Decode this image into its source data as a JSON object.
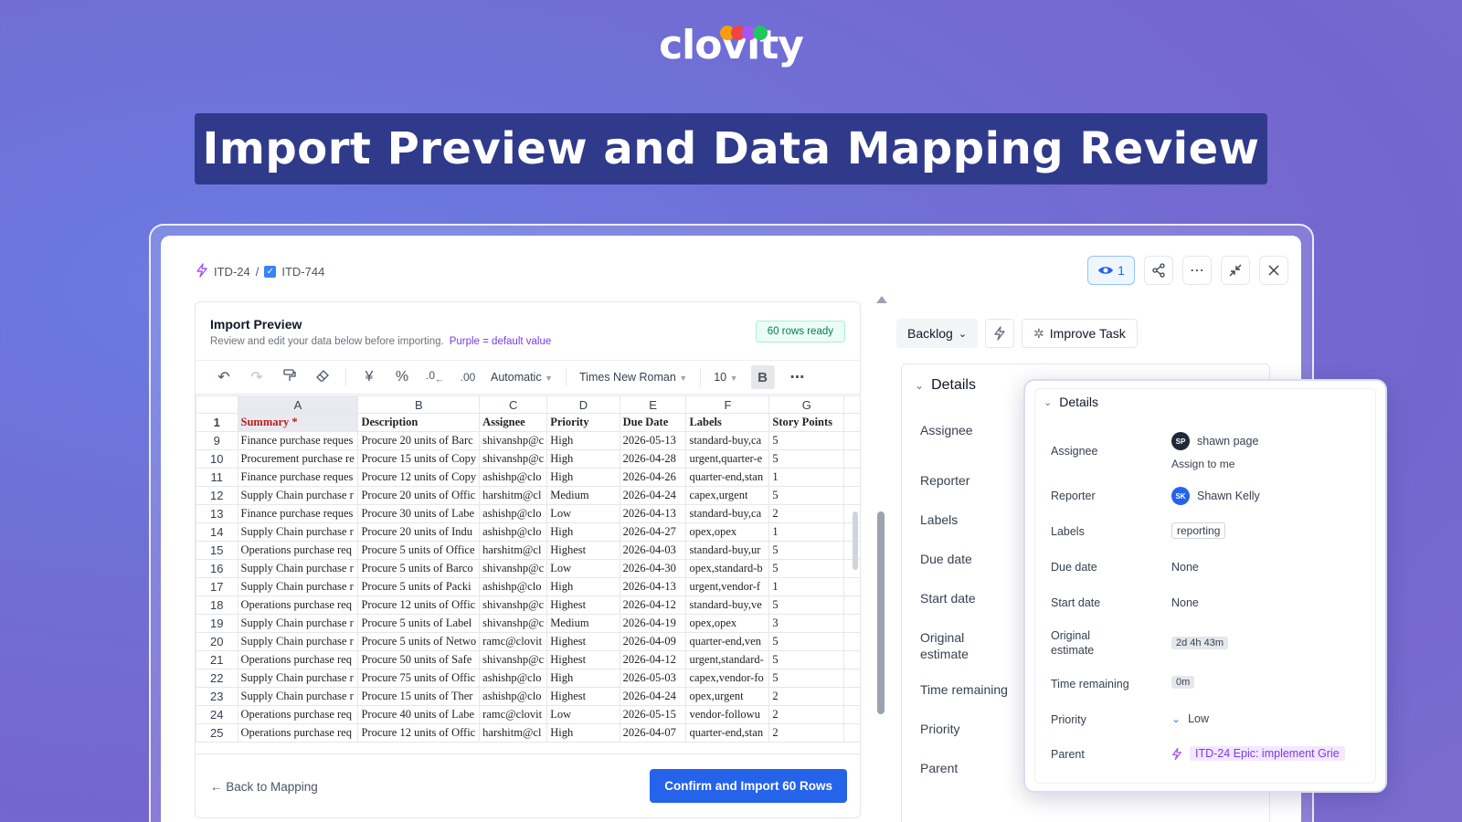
{
  "brand": {
    "logo": "clovity",
    "dots": [
      "#f59e0b",
      "#ef4444",
      "#a855f7",
      "#22c55e"
    ]
  },
  "banner": {
    "title": "Import Preview and Data Mapping Review"
  },
  "breadcrumb": {
    "epic": "ITD-24",
    "separator": "/",
    "task": "ITD-744"
  },
  "top_actions": {
    "watch_count": "1"
  },
  "import_preview": {
    "title": "Import Preview",
    "subtitle": "Review and edit your data below before importing.",
    "legend": "Purple = default value",
    "rows_ready": "60 rows ready",
    "toolbar": {
      "format": "Automatic",
      "font": "Times New Roman",
      "size": "10",
      "bold": "B"
    },
    "columns": [
      "A",
      "B",
      "C",
      "D",
      "E",
      "F",
      "G"
    ],
    "header_row": {
      "num": "1",
      "cells": [
        "Summary *",
        "Description",
        "Assignee",
        "Priority",
        "Due Date",
        "Labels",
        "Story Points"
      ]
    },
    "rows": [
      {
        "n": "9",
        "c": [
          "Finance purchase reques",
          "Procure 20 units of Barc",
          "shivanshp@c",
          "High",
          "2026-05-13",
          "standard-buy,ca",
          "5"
        ]
      },
      {
        "n": "10",
        "c": [
          "Procurement purchase re",
          "Procure 15 units of Copy",
          "shivanshp@c",
          "High",
          "2026-04-28",
          "urgent,quarter-e",
          "5"
        ]
      },
      {
        "n": "11",
        "c": [
          "Finance purchase reques",
          "Procure 12 units of Copy",
          "ashishp@clo",
          "High",
          "2026-04-26",
          "quarter-end,stan",
          "1"
        ]
      },
      {
        "n": "12",
        "c": [
          "Supply Chain purchase r",
          "Procure 20 units of Offic",
          "harshitm@cl",
          "Medium",
          "2026-04-24",
          "capex,urgent",
          "5"
        ]
      },
      {
        "n": "13",
        "c": [
          "Finance purchase reques",
          "Procure 30 units of Labe",
          "ashishp@clo",
          "Low",
          "2026-04-13",
          "standard-buy,ca",
          "2"
        ]
      },
      {
        "n": "14",
        "c": [
          "Supply Chain purchase r",
          "Procure 20 units of Indu",
          "ashishp@clo",
          "High",
          "2026-04-27",
          "opex,opex",
          "1"
        ]
      },
      {
        "n": "15",
        "c": [
          "Operations purchase req",
          "Procure 5 units of Office",
          "harshitm@cl",
          "Highest",
          "2026-04-03",
          "standard-buy,ur",
          "5"
        ]
      },
      {
        "n": "16",
        "c": [
          "Supply Chain purchase r",
          "Procure 5 units of Barco",
          "shivanshp@c",
          "Low",
          "2026-04-30",
          "opex,standard-b",
          "5"
        ]
      },
      {
        "n": "17",
        "c": [
          "Supply Chain purchase r",
          "Procure 5 units of Packi",
          "ashishp@clo",
          "High",
          "2026-04-13",
          "urgent,vendor-f",
          "1"
        ]
      },
      {
        "n": "18",
        "c": [
          "Operations purchase req",
          "Procure 12 units of Offic",
          "shivanshp@c",
          "Highest",
          "2026-04-12",
          "standard-buy,ve",
          "5"
        ]
      },
      {
        "n": "19",
        "c": [
          "Supply Chain purchase r",
          "Procure 5 units of Label",
          "shivanshp@c",
          "Medium",
          "2026-04-19",
          "opex,opex",
          "3"
        ]
      },
      {
        "n": "20",
        "c": [
          "Supply Chain purchase r",
          "Procure 5 units of Netwo",
          "ramc@clovit",
          "Highest",
          "2026-04-09",
          "quarter-end,ven",
          "5"
        ]
      },
      {
        "n": "21",
        "c": [
          "Operations purchase req",
          "Procure 50 units of Safe",
          "shivanshp@c",
          "Highest",
          "2026-04-12",
          "urgent,standard-",
          "5"
        ]
      },
      {
        "n": "22",
        "c": [
          "Supply Chain purchase r",
          "Procure 75 units of Offic",
          "ashishp@clo",
          "High",
          "2026-05-03",
          "capex,vendor-fo",
          "5"
        ]
      },
      {
        "n": "23",
        "c": [
          "Supply Chain purchase r",
          "Procure 15 units of Ther",
          "ashishp@clo",
          "Highest",
          "2026-04-24",
          "opex,urgent",
          "2"
        ]
      },
      {
        "n": "24",
        "c": [
          "Operations purchase req",
          "Procure 40 units of Labe",
          "ramc@clovit",
          "Low",
          "2026-05-15",
          "vendor-followu",
          "2"
        ]
      },
      {
        "n": "25",
        "c": [
          "Operations purchase req",
          "Procure 12 units of Offic",
          "harshitm@cl",
          "High",
          "2026-04-07",
          "quarter-end,stan",
          "2"
        ]
      }
    ],
    "back_label": "← Back to Mapping",
    "confirm_label": "Confirm and Import 60 Rows"
  },
  "status": {
    "backlog": "Backlog",
    "improve": "Improve Task"
  },
  "details_back": {
    "title": "Details",
    "labels": [
      "Assignee",
      "Reporter",
      "Labels",
      "Due date",
      "Start date",
      "Original estimate",
      "Time remaining",
      "Priority",
      "Parent"
    ]
  },
  "details_popup": {
    "title": "Details",
    "assignee_label": "Assignee",
    "assignee_initials": "SP",
    "assignee_name": "shawn page",
    "assign_to_me": "Assign to me",
    "reporter_label": "Reporter",
    "reporter_initials": "SK",
    "reporter_name": "Shawn Kelly",
    "labels_label": "Labels",
    "labels_value": "reporting",
    "due_label": "Due date",
    "due_value": "None",
    "start_label": "Start date",
    "start_value": "None",
    "orig_label_1": "Original",
    "orig_label_2": "estimate",
    "orig_value": "2d 4h 43m",
    "remaining_label": "Time remaining",
    "remaining_value": "0m",
    "priority_label": "Priority",
    "priority_value": "Low",
    "parent_label": "Parent",
    "parent_value": "ITD-24 Epic: implement Grie"
  },
  "colors": {
    "accent": "#2563eb",
    "required": "#b91c1c",
    "default_value": "#7c3aed",
    "sp_avatar": "#1f2937",
    "sk_avatar": "#2563eb"
  }
}
